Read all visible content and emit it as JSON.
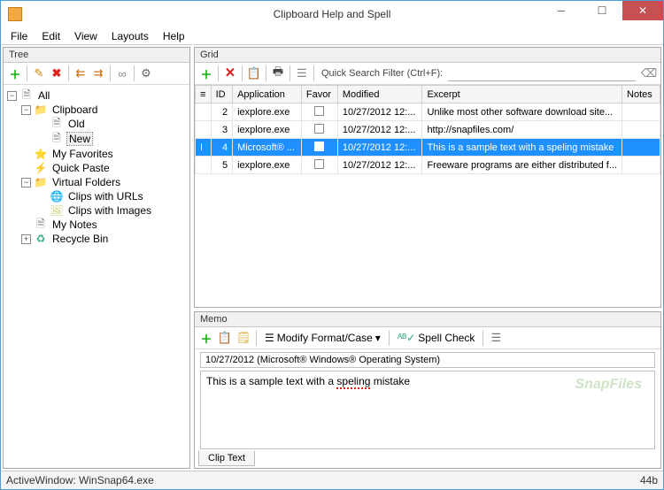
{
  "window": {
    "title": "Clipboard Help and Spell"
  },
  "menubar": {
    "items": [
      "File",
      "Edit",
      "View",
      "Layouts",
      "Help"
    ]
  },
  "tree": {
    "header": "Tree",
    "nodes": {
      "all": "All",
      "clipboard": "Clipboard",
      "old": "Old",
      "new": "New",
      "fav": "My Favorites",
      "qp": "Quick Paste",
      "vf": "Virtual Folders",
      "vf_url": "Clips with URLs",
      "vf_img": "Clips with Images",
      "notes": "My Notes",
      "recycle": "Recycle Bin"
    }
  },
  "grid": {
    "header": "Grid",
    "qsf_label": "Quick Search Filter (Ctrl+F):",
    "columns": {
      "id": "ID",
      "app": "Application",
      "favor": "Favor",
      "modified": "Modified",
      "excerpt": "Excerpt",
      "notes": "Notes"
    },
    "rows": [
      {
        "id": "2",
        "app": "iexplore.exe",
        "modified": "10/27/2012 12:...",
        "excerpt": "Unlike most other software download site...",
        "notes": ""
      },
      {
        "id": "3",
        "app": "iexplore.exe",
        "modified": "10/27/2012 12:...",
        "excerpt": "http://snapfiles.com/",
        "notes": ""
      },
      {
        "id": "4",
        "app": "Microsoft® ...",
        "modified": "10/27/2012 12:...",
        "excerpt": "This is a sample text with a speling mistake",
        "notes": ""
      },
      {
        "id": "5",
        "app": "iexplore.exe",
        "modified": "10/27/2012 12:...",
        "excerpt": "Freeware programs are either distributed f...",
        "notes": ""
      }
    ],
    "selected_index": 2
  },
  "memo": {
    "header": "Memo",
    "modify_label": "Modify Format/Case",
    "spell_label": "Spell Check",
    "info": "10/27/2012 (Microsoft® Windows® Operating System)",
    "content_before": "This is a sample text with a ",
    "content_err": "speling",
    "content_after": " mistake",
    "tab": "Clip Text",
    "watermark": "SnapFiles"
  },
  "status": {
    "left": "ActiveWindow: WinSnap64.exe",
    "right": "44b"
  }
}
